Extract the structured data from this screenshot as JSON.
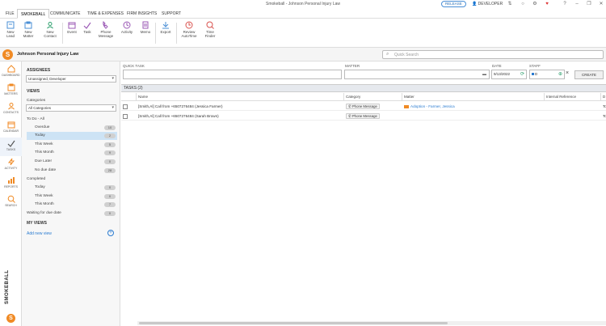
{
  "window": {
    "title": "Smokeball - Johnson Personal Injury Law",
    "release_badge": "RELEASE",
    "user_label": "DEVELOPER"
  },
  "menu": {
    "tabs": [
      "FILE",
      "SMOKEBALL",
      "COMMUNICATE",
      "TIME & EXPENSES",
      "FIRM INSIGHTS",
      "SUPPORT"
    ],
    "active": "SMOKEBALL"
  },
  "ribbon": {
    "buttons": [
      {
        "label": "New\nLead",
        "icon": "new-lead-icon"
      },
      {
        "label": "New\nMatter",
        "icon": "new-matter-icon"
      },
      {
        "label": "New\nContact",
        "icon": "new-contact-icon"
      },
      {
        "label": "Event",
        "icon": "event-icon"
      },
      {
        "label": "Task",
        "icon": "task-icon"
      },
      {
        "label": "Phone\nMessage",
        "icon": "phone-message-icon"
      },
      {
        "label": "Activity",
        "icon": "activity-icon"
      },
      {
        "label": "Memo",
        "icon": "memo-icon"
      },
      {
        "label": "Export",
        "icon": "export-icon"
      },
      {
        "label": "Review\nAutoTime",
        "icon": "review-autotime-icon"
      },
      {
        "label": "Time\nFinder",
        "icon": "time-finder-icon"
      }
    ]
  },
  "firm": {
    "name": "Johnson Personal Injury Law",
    "search_placeholder": "Quick Search"
  },
  "leftnav": {
    "items": [
      "DASHBOARD",
      "MATTERS",
      "CONTACTS",
      "CALENDAR",
      "TASKS",
      "ACTIVITY",
      "REPORTS",
      "SEARCH"
    ],
    "active": "TASKS",
    "brand": "SMOKEBALL"
  },
  "sidepanel": {
    "assignees_header": "ASSIGNEES",
    "assignee_value": "Unassigned, Developer",
    "views_header": "VIEWS",
    "categories_label": "Categories",
    "categories_value": "All Categories",
    "todo_label": "To Do - All",
    "todo": [
      {
        "label": "Overdue",
        "count": "10"
      },
      {
        "label": "Today",
        "count": "2"
      },
      {
        "label": "This Week",
        "count": "5"
      },
      {
        "label": "This Month",
        "count": "9"
      },
      {
        "label": "Due Later",
        "count": "0"
      },
      {
        "label": "No due date",
        "count": "28"
      }
    ],
    "completed_label": "Completed",
    "completed": [
      {
        "label": "Today",
        "count": "0"
      },
      {
        "label": "This Week",
        "count": "0"
      },
      {
        "label": "This Month",
        "count": "7"
      }
    ],
    "waiting": {
      "label": "Waiting for due date",
      "count": "0"
    },
    "myviews_header": "MY VIEWS",
    "add_view": "Add new view"
  },
  "quicktask": {
    "task_label": "QUICK TASK",
    "matter_label": "MATTER",
    "date_label": "DATE",
    "date_value": "9/13/2022",
    "staff_label": "STAFF",
    "staff_value": "D",
    "create_label": "CREATE"
  },
  "tasks": {
    "header": "TASKS (2)",
    "columns": [
      "Name",
      "Category",
      "Matter",
      "Internal Reference",
      "D"
    ],
    "rows": [
      {
        "name": "[Smith,Al] Call from +6507276484 (Jessica Farmer)",
        "category": "Phone Message",
        "matter": "Adoption - Farmer, Jessica",
        "due": "To"
      },
      {
        "name": "[Smith,Al] Call from +6507276484 (Sarah Brown)",
        "category": "Phone Message",
        "matter": "",
        "due": "To"
      }
    ]
  }
}
